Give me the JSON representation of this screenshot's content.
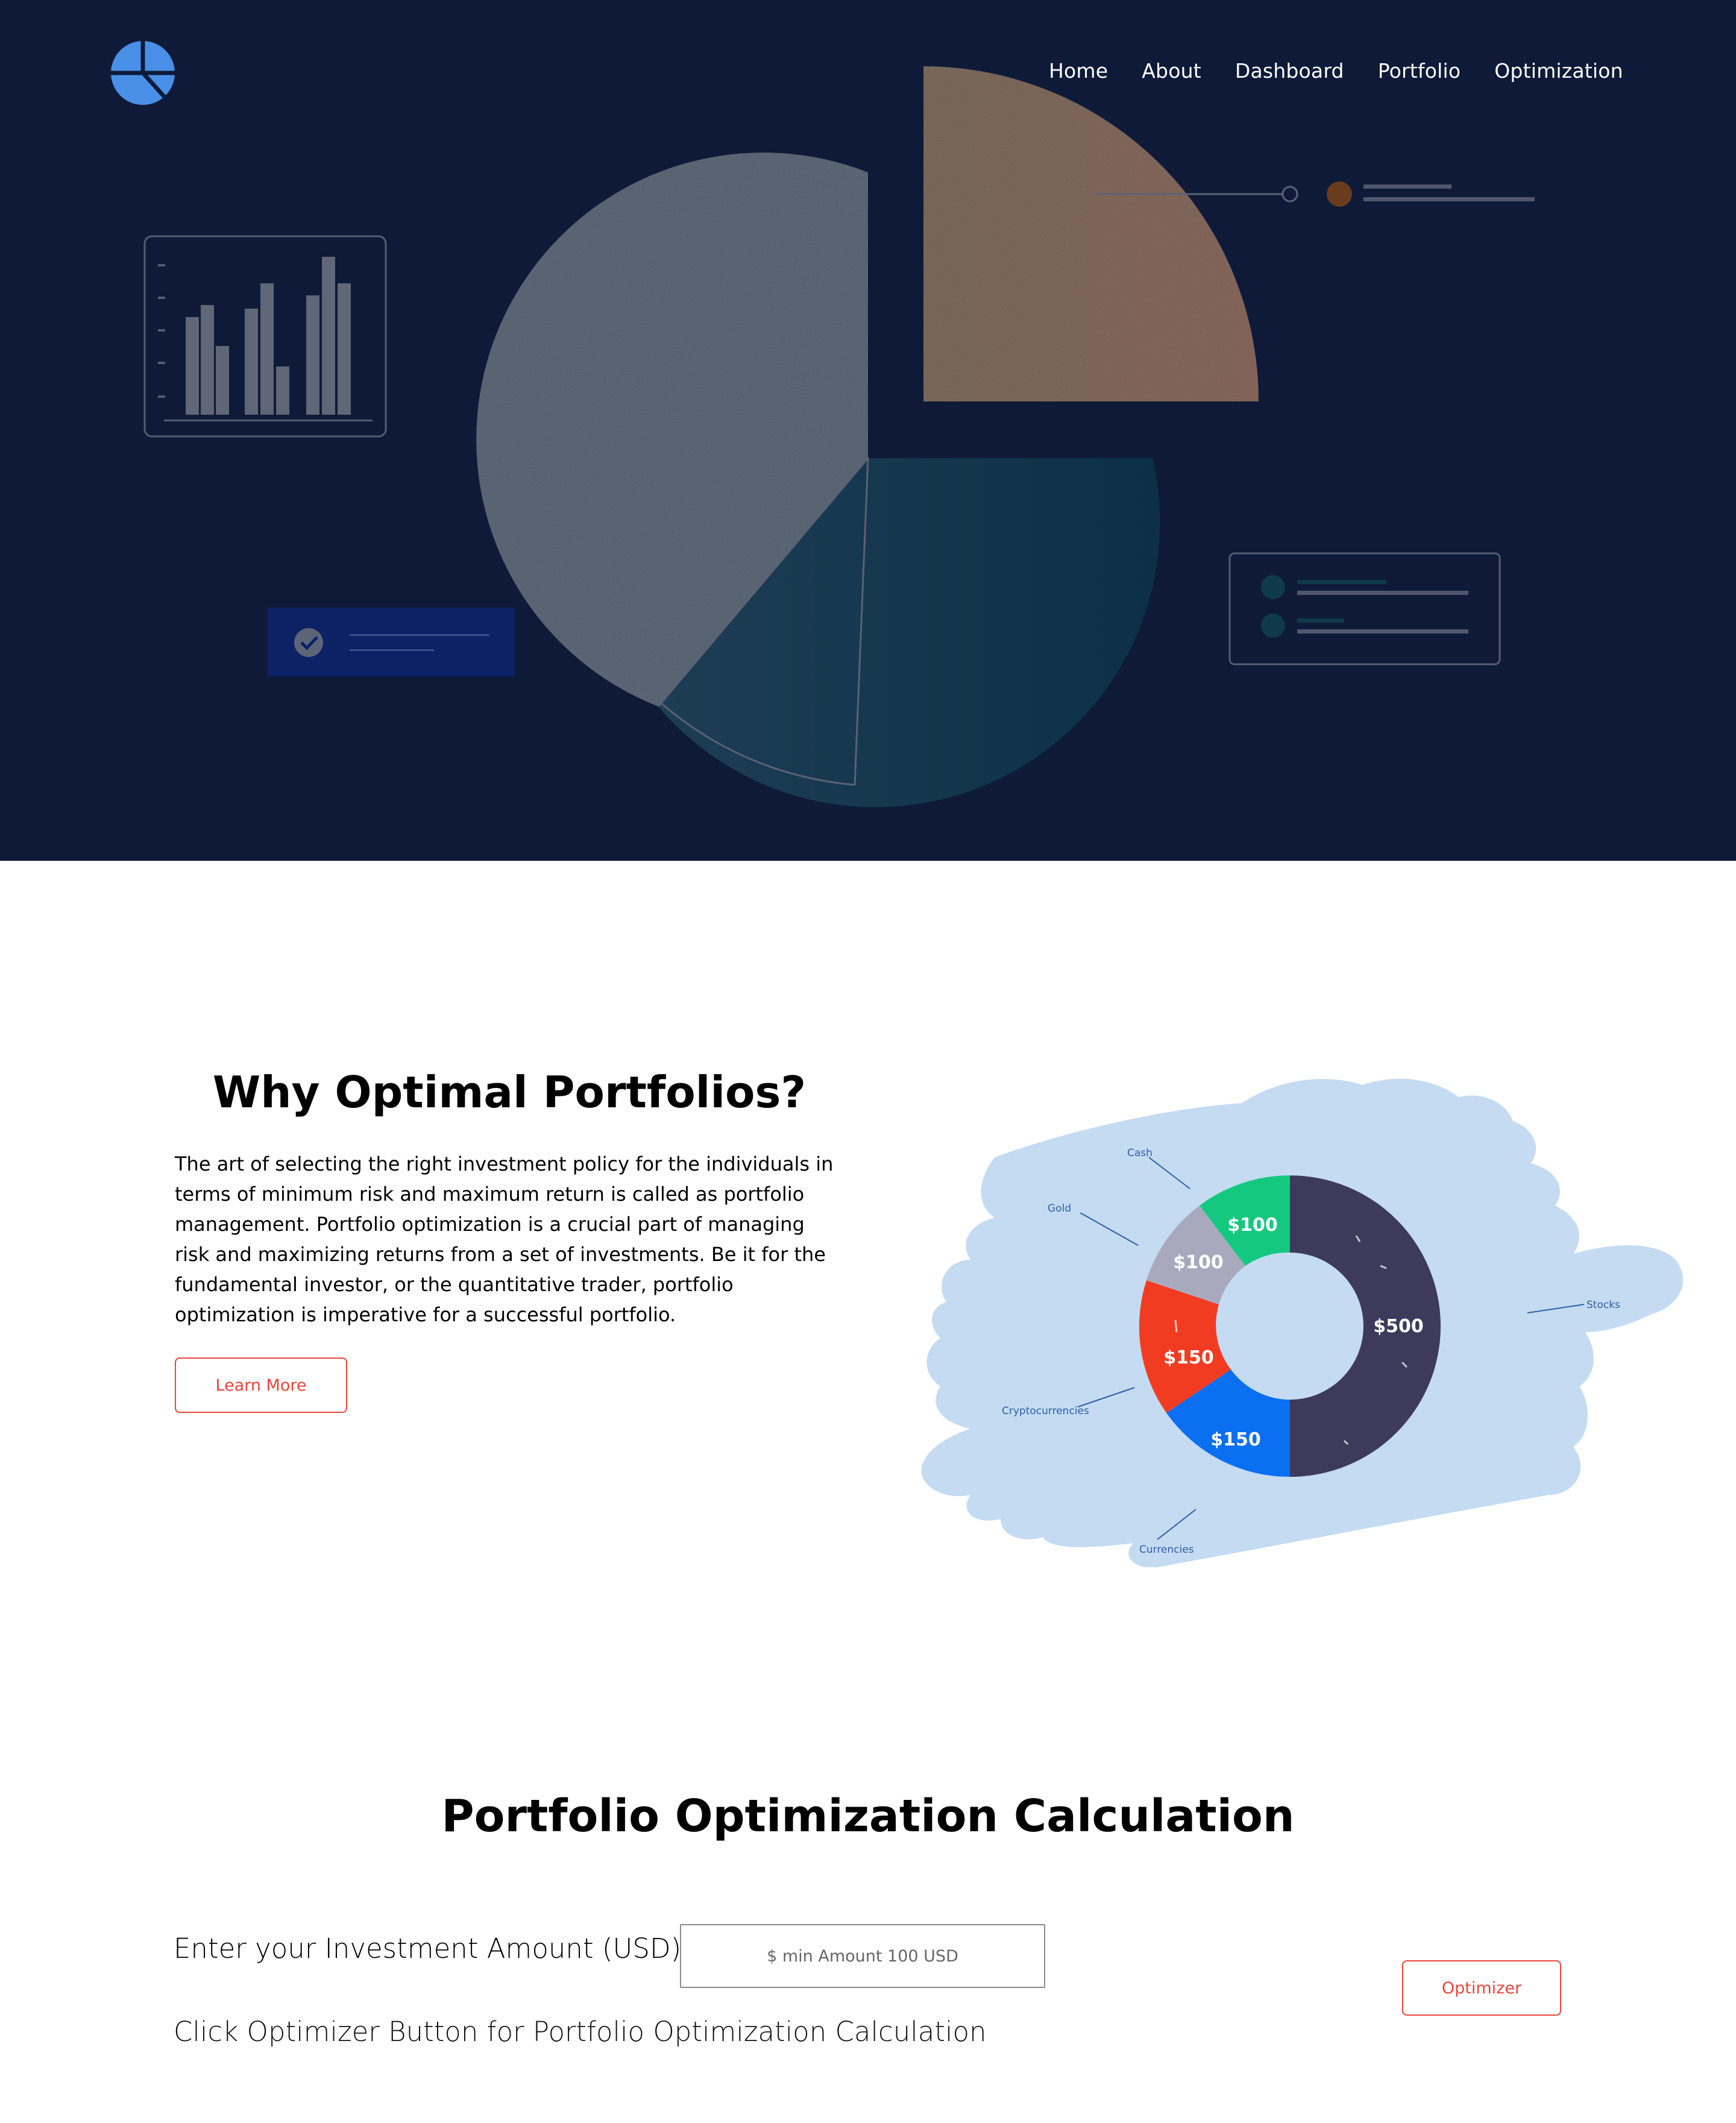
{
  "nav": {
    "items": [
      {
        "label": "Home"
      },
      {
        "label": "About"
      },
      {
        "label": "Dashboard"
      },
      {
        "label": "Portfolio"
      },
      {
        "label": "Optimization"
      }
    ]
  },
  "colors": {
    "hero_bg": "#0e1a38",
    "logo": "#4a8fe7",
    "accent_red": "#e8463b",
    "donut_stocks": "#3d3a5c",
    "donut_cash": "#14c97f",
    "donut_gold": "#a9a9bd",
    "donut_crypto": "#f23c22",
    "donut_currencies": "#0a6ff0",
    "splash": "#c4dbf2"
  },
  "why": {
    "title": "Why Optimal Portfolios?",
    "body": "The art of selecting the right investment policy for the individuals in terms of minimum risk and maximum return is called as portfolio management. Portfolio optimization is a crucial part of managing risk and maximizing returns from a set of investments. Be it for the fundamental investor, or the quantitative trader, portfolio optimization is imperative for a successful portfolio.",
    "button": "Learn More"
  },
  "donut": {
    "segments": [
      {
        "name": "Stocks",
        "value_label": "$500",
        "value": 500
      },
      {
        "name": "Currencies",
        "value_label": "$150",
        "value": 150
      },
      {
        "name": "Cryptocurrencies",
        "value_label": "$150",
        "value": 150
      },
      {
        "name": "Gold",
        "value_label": "$100",
        "value": 100
      },
      {
        "name": "Cash",
        "value_label": "$100",
        "value": 100
      }
    ]
  },
  "calc": {
    "title": "Portfolio Optimization Calculation",
    "amount_label": "Enter your Investment Amount (USD)",
    "amount_placeholder": "$ min Amount 100 USD",
    "amount_value": "",
    "hint": "Click Optimizer Button for Portfolio Optimization Calculation",
    "button": "Optimizer"
  }
}
